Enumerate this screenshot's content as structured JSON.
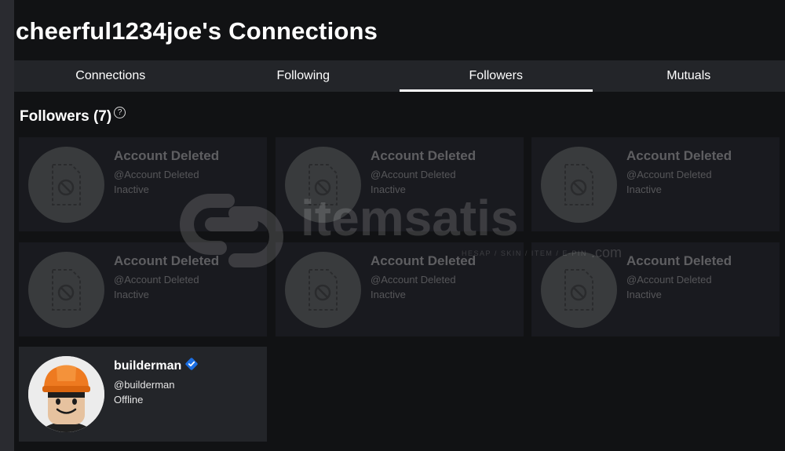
{
  "page_title": "cheerful1234joe's Connections",
  "tabs": [
    {
      "label": "Connections"
    },
    {
      "label": "Following"
    },
    {
      "label": "Followers"
    },
    {
      "label": "Mutuals"
    }
  ],
  "active_tab": "Followers",
  "section": {
    "heading": "Followers (7)",
    "help_glyph": "?"
  },
  "deleted_cards": [
    {
      "name": "Account Deleted",
      "handle": "@Account Deleted",
      "status": "Inactive"
    },
    {
      "name": "Account Deleted",
      "handle": "@Account Deleted",
      "status": "Inactive"
    },
    {
      "name": "Account Deleted",
      "handle": "@Account Deleted",
      "status": "Inactive"
    },
    {
      "name": "Account Deleted",
      "handle": "@Account Deleted",
      "status": "Inactive"
    },
    {
      "name": "Account Deleted",
      "handle": "@Account Deleted",
      "status": "Inactive"
    },
    {
      "name": "Account Deleted",
      "handle": "@Account Deleted",
      "status": "Inactive"
    }
  ],
  "user_card": {
    "name": "builderman",
    "handle": "@builderman",
    "status": "Offline",
    "verified": true
  },
  "watermark": {
    "brand": "itemsatis",
    "tagline": "HESAP / SKIN / ITEM / E-PIN",
    "suffix": ".com"
  },
  "colors": {
    "background": "#111214",
    "tabbar": "#232529",
    "card": "#191a1f",
    "verified": "#1b6fe3",
    "hat": "#ee7a20",
    "skin": "#e6c29f"
  }
}
